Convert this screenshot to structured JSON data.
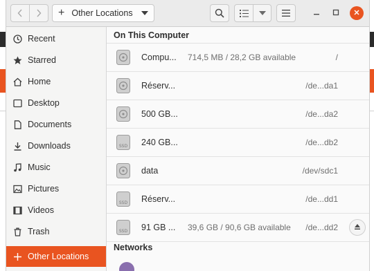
{
  "toolbar": {
    "location_label": "Other Locations"
  },
  "sidebar": {
    "items": [
      {
        "label": "Recent",
        "icon": "clock-icon"
      },
      {
        "label": "Starred",
        "icon": "star-icon"
      },
      {
        "label": "Home",
        "icon": "home-icon"
      },
      {
        "label": "Desktop",
        "icon": "desktop-icon"
      },
      {
        "label": "Documents",
        "icon": "document-icon"
      },
      {
        "label": "Downloads",
        "icon": "download-icon"
      },
      {
        "label": "Music",
        "icon": "music-icon"
      },
      {
        "label": "Pictures",
        "icon": "picture-icon"
      },
      {
        "label": "Videos",
        "icon": "video-icon"
      },
      {
        "label": "Trash",
        "icon": "trash-icon"
      },
      {
        "label": "Other Locations",
        "icon": "plus-icon"
      }
    ]
  },
  "main": {
    "on_this_computer": "On This Computer",
    "networks": "Networks",
    "volumes": [
      {
        "name": "Compu...",
        "available": "714,5 MB / 28,2 GB available",
        "path": "/",
        "type": "hdd"
      },
      {
        "name": "Réserv...",
        "available": "",
        "path": "/de...da1",
        "type": "hdd"
      },
      {
        "name": "500 GB...",
        "available": "",
        "path": "/de...da2",
        "type": "hdd"
      },
      {
        "name": "240 GB...",
        "available": "",
        "path": "/de...db2",
        "type": "ssd"
      },
      {
        "name": "data",
        "available": "",
        "path": "/dev/sdc1",
        "type": "hdd"
      },
      {
        "name": "Réserv...",
        "available": "",
        "path": "/de...dd1",
        "type": "ssd"
      },
      {
        "name": "91 GB ...",
        "available": "39,6 GB / 90,6 GB available",
        "path": "/de...dd2",
        "type": "ssd"
      }
    ]
  },
  "colors": {
    "accent": "#e95420",
    "sidebar_bg": "#f5f5f4",
    "header_bg": "#ebebeb"
  }
}
